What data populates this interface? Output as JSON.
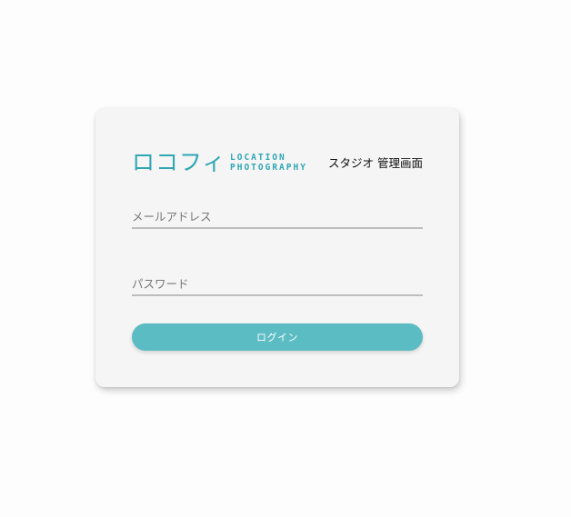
{
  "brand": {
    "logo_jp": "ロコフィ",
    "logo_en_line1": "LOCATION",
    "logo_en_line2": "PHOTOGRAPHY",
    "subtitle": "スタジオ 管理画面"
  },
  "form": {
    "email_placeholder": "メールアドレス",
    "email_value": "",
    "password_placeholder": "パスワード",
    "password_value": "",
    "login_label": "ログイン"
  },
  "colors": {
    "accent": "#2fa6b3",
    "button": "#5bbcc3",
    "card_bg": "#f5f5f5",
    "page_bg": "#fdfdfd"
  }
}
